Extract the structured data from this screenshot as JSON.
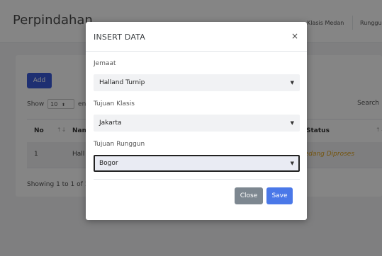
{
  "page": {
    "title": "Perpindahan",
    "top_nav": [
      "Klasis Medan",
      "Runggun"
    ]
  },
  "toolbar": {
    "add_label": "Add"
  },
  "table_controls": {
    "show_label": "Show",
    "page_length": "10",
    "entries_label": "ent",
    "search_label": "Search"
  },
  "table": {
    "headers": [
      "No",
      "Nam",
      "Status"
    ],
    "sort_glyph": "↑↓",
    "rows": [
      {
        "no": "1",
        "name": "Hall",
        "status": "Sedang Diproses"
      }
    ],
    "info": "Showing 1 to 1 of 1"
  },
  "modal": {
    "title": "INSERT DATA",
    "close_glyph": "×",
    "fields": [
      {
        "label": "Jemaat",
        "value": "Halland Turnip"
      },
      {
        "label": "Tujuan Klasis",
        "value": "Jakarta"
      },
      {
        "label": "Tujuan Runggun",
        "value": "Bogor"
      }
    ],
    "close_label": "Close",
    "save_label": "Save"
  },
  "colors": {
    "primary": "#3b5bdb",
    "save": "#4a78e8",
    "close_button": "#7d8790",
    "status_pending": "#e0a21c"
  }
}
